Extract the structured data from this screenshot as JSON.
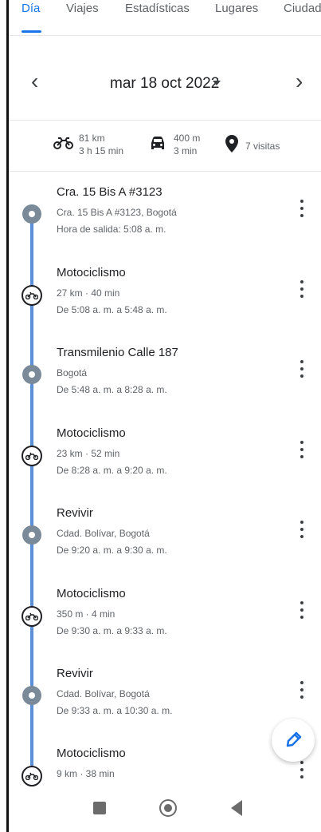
{
  "tabs": [
    {
      "label": "Día",
      "active": true
    },
    {
      "label": "Viajes"
    },
    {
      "label": "Estadísticas"
    },
    {
      "label": "Lugares"
    },
    {
      "label": "Ciudad"
    }
  ],
  "date_nav": {
    "prev": "‹",
    "date": "mar 18 oct 2022",
    "next": "›"
  },
  "summary": {
    "moto": {
      "icon": "motorcycle-icon",
      "distance": "81 km",
      "duration": "3 h 15 min"
    },
    "car": {
      "icon": "car-icon",
      "distance": "400 m",
      "duration": "3 min"
    },
    "visits": {
      "icon": "location-pin-icon",
      "text": "7 visitas"
    }
  },
  "timeline": [
    {
      "type": "place",
      "title": "Cra. 15 Bis A #3123",
      "line1": "Cra. 15 Bis A #3123, Bogotá",
      "line2": "Hora de salida: 5:08 a. m."
    },
    {
      "type": "activity",
      "title": "Motociclismo",
      "line1": "27 km · 40 min",
      "line2": "De 5:08 a. m. a 5:48 a. m."
    },
    {
      "type": "place",
      "title": "Transmilenio Calle 187",
      "line1": "Bogotá",
      "line2": "De 5:48 a. m. a 8:28 a. m."
    },
    {
      "type": "activity",
      "title": "Motociclismo",
      "line1": "23 km · 52 min",
      "line2": "De 8:28 a. m. a 9:20 a. m."
    },
    {
      "type": "place",
      "title": "Revivir",
      "line1": "Cdad. Bolívar, Bogotá",
      "line2": "De 9:20 a. m. a 9:30 a. m."
    },
    {
      "type": "activity",
      "title": "Motociclismo",
      "line1": "350 m · 4 min",
      "line2": "De 9:30 a. m. a 9:33 a. m."
    },
    {
      "type": "place",
      "title": "Revivir",
      "line1": "Cdad. Bolívar, Bogotá",
      "line2": "De 9:33 a. m. a 10:30 a. m."
    },
    {
      "type": "activity",
      "title": "Motociclismo",
      "line1": "9 km · 38 min",
      "line2": ""
    }
  ],
  "colors": {
    "accent": "#1a73e8",
    "timeline": "#5b8fd6",
    "place_dot": "#7a8a99"
  }
}
